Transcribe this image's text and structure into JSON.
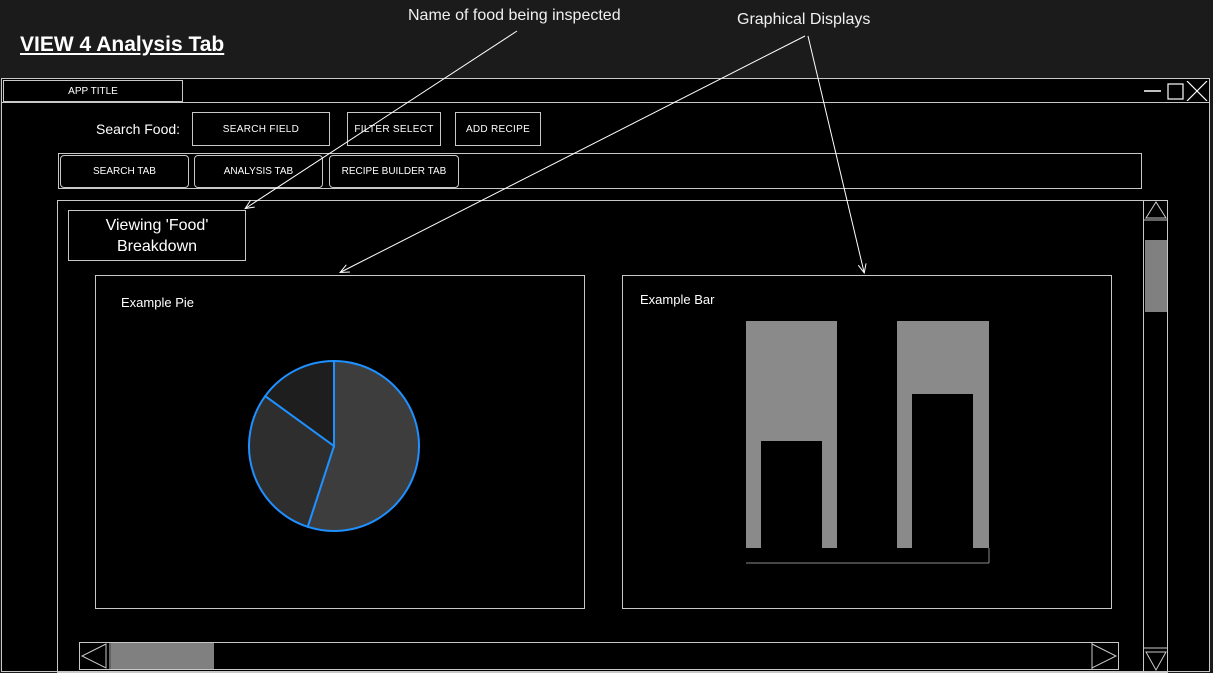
{
  "page": {
    "heading": "VIEW 4 Analysis Tab",
    "annotations": {
      "food_name": "Name of food being inspected",
      "graphs": "Graphical Displays"
    }
  },
  "window": {
    "app_title": "APP TITLE",
    "controls": [
      "minimize-icon",
      "maximize-icon",
      "close-icon"
    ]
  },
  "toolbar": {
    "search_label": "Search Food:",
    "search_field": "SEARCH FIELD",
    "filter_select": "FILTER SELECT",
    "add_recipe": "ADD RECIPE"
  },
  "tabs": [
    {
      "label": "SEARCH TAB"
    },
    {
      "label": "ANALYSIS TAB"
    },
    {
      "label": "RECIPE BUILDER TAB"
    }
  ],
  "content": {
    "food_title_line1": "Viewing 'Food'",
    "food_title_line2": "Breakdown",
    "pie": {
      "title": "Example Pie",
      "slices": [
        0.55,
        0.3,
        0.15
      ],
      "colors": [
        "#3d3d3d",
        "#2e2e2e",
        "#1e1e1e"
      ],
      "stroke": "#1e90ff"
    },
    "bar": {
      "title": "Example Bar",
      "bar_color": "#8a8a8a",
      "inner_values": [
        0.47,
        0.68
      ]
    }
  },
  "colors": {
    "background": "#1b1b1b",
    "window": "#000000",
    "border": "#c8c8c8",
    "scroll_thumb": "#808080"
  }
}
